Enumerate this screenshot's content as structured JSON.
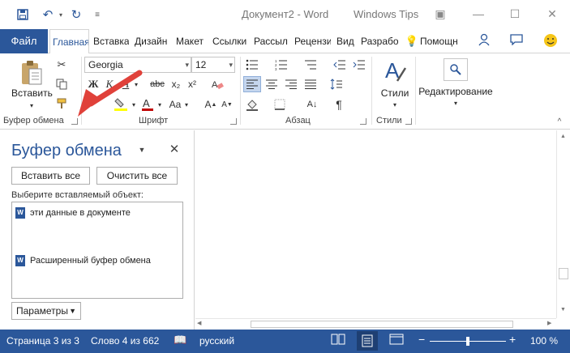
{
  "titlebar": {
    "document_title": "Документ2 - Word",
    "watermark": "Windows Tips",
    "icons": [
      "save-icon",
      "undo-icon",
      "redo-icon",
      "customize-icon",
      "ribbon-display-icon",
      "minimize-icon",
      "maximize-icon",
      "close-icon"
    ]
  },
  "tabs": {
    "file": "Файл",
    "items": [
      "Главная",
      "Вставка",
      "Дизайн",
      "Макет",
      "Ссылки",
      "Рассыл",
      "Рецензи",
      "Вид",
      "Разрабо"
    ],
    "active": "Главная",
    "tell_me": "Помощн"
  },
  "ribbon": {
    "clipboard": {
      "label": "Буфер обмена",
      "paste_label": "Вставить"
    },
    "font": {
      "label": "Шрифт",
      "font_name": "Georgia",
      "font_size": "12"
    },
    "paragraph": {
      "label": "Абзац"
    },
    "styles": {
      "label": "Стили",
      "button_label": "Стили"
    },
    "editing": {
      "label": "Редактирование"
    }
  },
  "pane": {
    "title": "Буфер обмена",
    "paste_all": "Вставить все",
    "clear_all": "Очистить все",
    "select_label": "Выберите вставляемый объект:",
    "items": [
      "эти данные в документе",
      "Расширенный буфер обмена"
    ],
    "options_button": "Параметры"
  },
  "statusbar": {
    "page": "Страница 3 из 3",
    "words": "Слово 4 из 662",
    "language": "русский",
    "zoom": "100 %"
  },
  "colors": {
    "accent": "#2b579a",
    "annotation_arrow": "#e0413a",
    "font_color_red": "#c00000",
    "highlight_yellow": "#ffff00"
  }
}
